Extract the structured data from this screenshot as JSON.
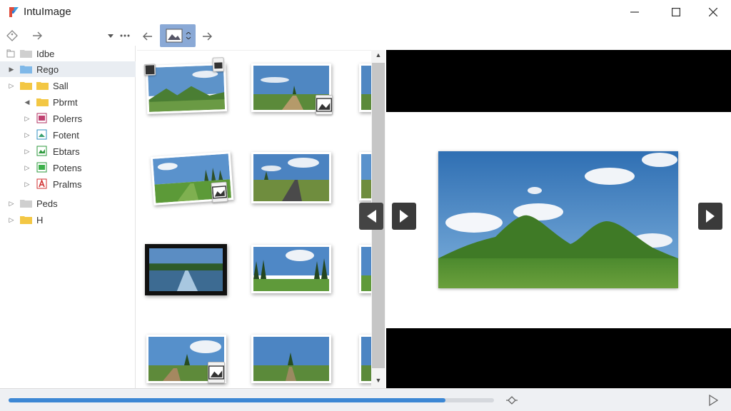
{
  "app": {
    "title": "IntuImage",
    "accent_color": "#3c87d4"
  },
  "window_controls": [
    "minimize-icon",
    "maximize-icon",
    "close-icon"
  ],
  "left_toolbar": {
    "icons": [
      "tag-icon",
      "forward-arrow-icon",
      "dropdown-icon",
      "more-icon"
    ]
  },
  "tree": {
    "items": [
      {
        "label": "Idbe",
        "icon": "folder-icon"
      },
      {
        "label": "Rego",
        "icon": "folder-icon",
        "selected": true
      },
      {
        "label": "Sall",
        "icon": "folder-icon"
      },
      {
        "label": "Pbrmt",
        "icon": "folder-icon"
      },
      {
        "label": "Polerrs",
        "icon": "image-file-icon"
      },
      {
        "label": "Fotent",
        "icon": "image-file-icon"
      },
      {
        "label": "Ebtars",
        "icon": "image-file-icon"
      },
      {
        "label": "Potens",
        "icon": "image-file-icon"
      },
      {
        "label": "Pralms",
        "icon": "pdf-file-icon"
      },
      {
        "label": "Peds",
        "icon": "folder-icon"
      },
      {
        "label": "H",
        "icon": "folder-icon"
      }
    ]
  },
  "mid_toolbar": {
    "icons": [
      "back-arrow-icon",
      "image-view-icon",
      "forward-arrow-icon"
    ]
  },
  "preview": {
    "nav": [
      "previous-icon",
      "next-icon",
      "next-icon"
    ]
  },
  "status": {
    "progress": 0.9
  }
}
